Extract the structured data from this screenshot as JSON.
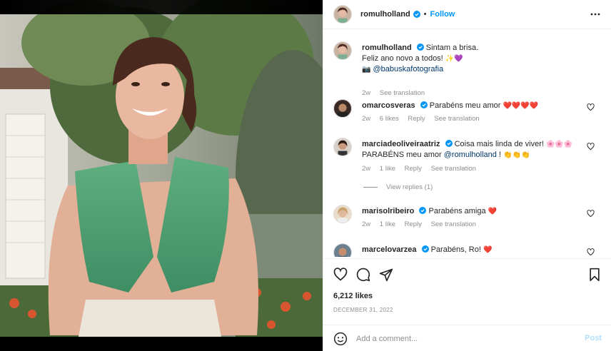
{
  "post": {
    "author": "romulholland",
    "follow_label": "Follow",
    "dot": "•"
  },
  "caption": {
    "user": "romulholland",
    "line1": "Sintam a brisa.",
    "line2": "Feliz ano novo a todos!",
    "line2_emoji": "✨💜",
    "line3_emoji": "📷",
    "line3_mention": "@babuskafotografia",
    "time": "2w",
    "translation": "See translation"
  },
  "comments": [
    {
      "user": "omarcosveras",
      "text": "Parabéns meu amor",
      "emoji": "❤️❤️❤️❤️",
      "time": "2w",
      "likes": "6 likes",
      "reply": "Reply",
      "translation": "See translation"
    },
    {
      "user": "marciadeoliveiraatriz",
      "text": "Coisa mais linda de viver!",
      "emoji": "🌸🌸🌸",
      "text2": "PARABÉNS meu amor",
      "mention": "@romulholland",
      "text3": "!",
      "emoji2": "👏👏👏",
      "time": "2w",
      "likes": "1 like",
      "reply": "Reply",
      "translation": "See translation"
    },
    {
      "user": "marisolribeiro",
      "text": "Parabéns amiga",
      "emoji": "❤️",
      "time": "2w",
      "likes": "1 like",
      "reply": "Reply",
      "translation": "See translation"
    },
    {
      "user": "marcelovarzea",
      "text": "Parabéns, Ro!",
      "emoji": "❤️"
    }
  ],
  "view_replies": "View replies (1)",
  "likes_count": "6,212 likes",
  "date": "DECEMBER 31, 2022",
  "add_comment": {
    "placeholder": "Add a comment...",
    "post_label": "Post"
  },
  "colors": {
    "accent": "#0095f6",
    "verified": "#0095f6",
    "post_disabled": "#b2dffc"
  }
}
